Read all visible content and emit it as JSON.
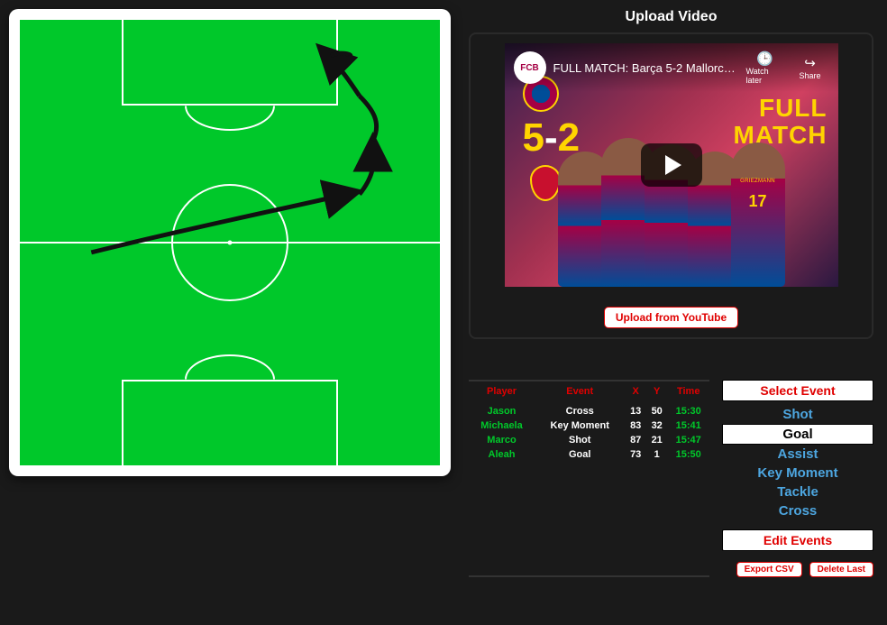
{
  "upload": {
    "title": "Upload Video",
    "video_title": "FULL MATCH: Barça 5-2 Mallorca (...",
    "watch_later": "Watch later",
    "share": "Share",
    "score_home": "5",
    "score_away": "2",
    "overlay_full": "FULL",
    "overlay_match": "MATCH",
    "jersey_17": "17",
    "button": "Upload from YouTube"
  },
  "table": {
    "headers": {
      "player": "Player",
      "event": "Event",
      "x": "X",
      "y": "Y",
      "time": "Time"
    },
    "rows": [
      {
        "player": "Jason",
        "event": "Cross",
        "x": "13",
        "y": "50",
        "time": "15:30"
      },
      {
        "player": "Michaela",
        "event": "Key Moment",
        "x": "83",
        "y": "32",
        "time": "15:41"
      },
      {
        "player": "Marco",
        "event": "Shot",
        "x": "87",
        "y": "21",
        "time": "15:47"
      },
      {
        "player": "Aleah",
        "event": "Goal",
        "x": "73",
        "y": "1",
        "time": "15:50"
      }
    ]
  },
  "events": {
    "select_header": "Select Event",
    "options": [
      "Shot",
      "Goal",
      "Assist",
      "Key Moment",
      "Tackle",
      "Cross"
    ],
    "selected": "Goal",
    "edit_header": "Edit Events",
    "export_btn": "Export CSV",
    "delete_btn": "Delete Last"
  }
}
